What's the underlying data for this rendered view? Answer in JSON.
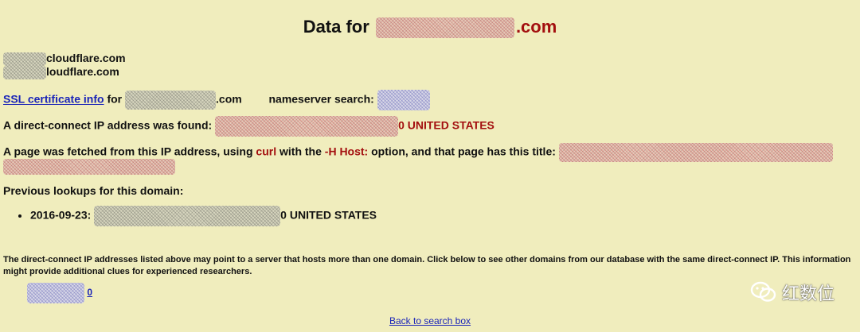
{
  "header": {
    "prefix": "Data for",
    "domain_suffix": ".com"
  },
  "nameservers": [
    {
      "text": "cloudflare.com"
    },
    {
      "text": "loudflare.com"
    }
  ],
  "ssl": {
    "link_label": "SSL certificate info",
    "for_text": "for",
    "domain_suffix": ".com",
    "ns_search_label": "nameserver search:"
  },
  "direct_ip": {
    "label": "A direct-connect IP address was found:",
    "result": "0 UNITED STATES"
  },
  "fetched": {
    "prefix": "A page was fetched from this IP address, using",
    "curl": "curl",
    "middle": "with the",
    "host_option": "-H Host:",
    "suffix": "option, and that page has this title:"
  },
  "previous": {
    "heading": "Previous lookups for this domain:",
    "items": [
      {
        "date": "2016-09-23:",
        "result": "0 UNITED STATES"
      }
    ]
  },
  "note": {
    "text": "The direct-connect IP addresses listed above may point to a server that hosts more than one domain. Click below to see other domains from our database with the same direct-connect IP. This information might provide additional clues for experienced researchers."
  },
  "other_domains": {
    "count_link": "0"
  },
  "footer": {
    "back_link": "Back to search box"
  },
  "watermark": {
    "icon": "wechat-icon",
    "text": "红数位"
  },
  "colors": {
    "background": "#f0edbd",
    "accent_red": "#a30f0f",
    "link_blue": "#1a24b8"
  }
}
